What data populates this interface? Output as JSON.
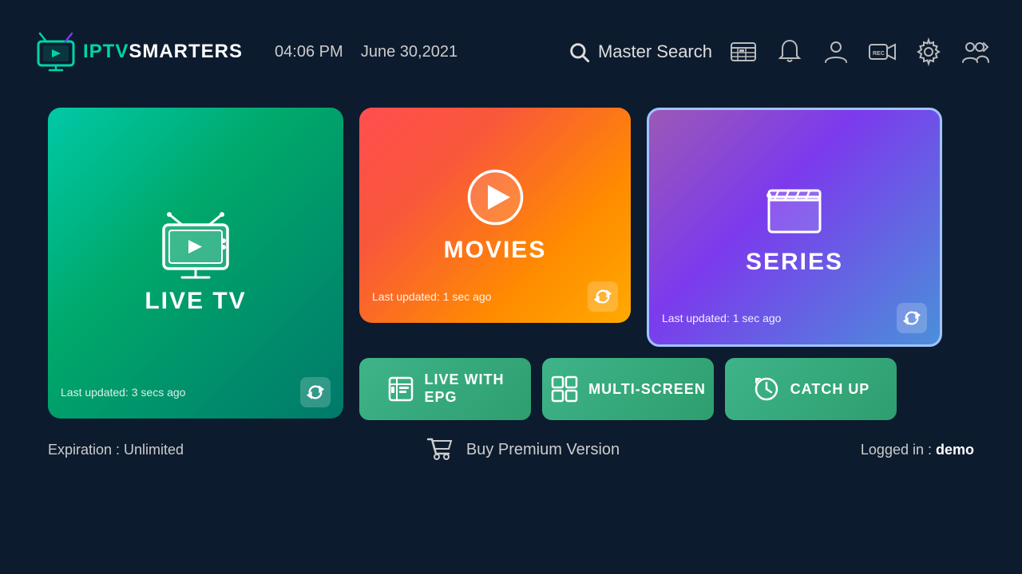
{
  "header": {
    "logo_iptv": "IPTV",
    "logo_smarters": "SMARTERS",
    "time": "04:06 PM",
    "date": "June 30,2021",
    "search_label": "Master Search"
  },
  "cards": {
    "live_tv": {
      "label": "LIVE TV",
      "last_updated": "Last updated: 3 secs ago"
    },
    "movies": {
      "label": "MOVIES",
      "last_updated": "Last updated: 1 sec ago"
    },
    "series": {
      "label": "SERIES",
      "last_updated": "Last updated: 1 sec ago"
    }
  },
  "buttons": {
    "live_epg_line1": "LIVE WITH",
    "live_epg_line2": "EPG",
    "multiscreen": "MULTI-SCREEN",
    "catchup": "CATCH UP"
  },
  "footer": {
    "expiration_label": "Expiration : Unlimited",
    "buy_premium": "Buy Premium Version",
    "logged_in_label": "Logged in : ",
    "username": "demo"
  }
}
